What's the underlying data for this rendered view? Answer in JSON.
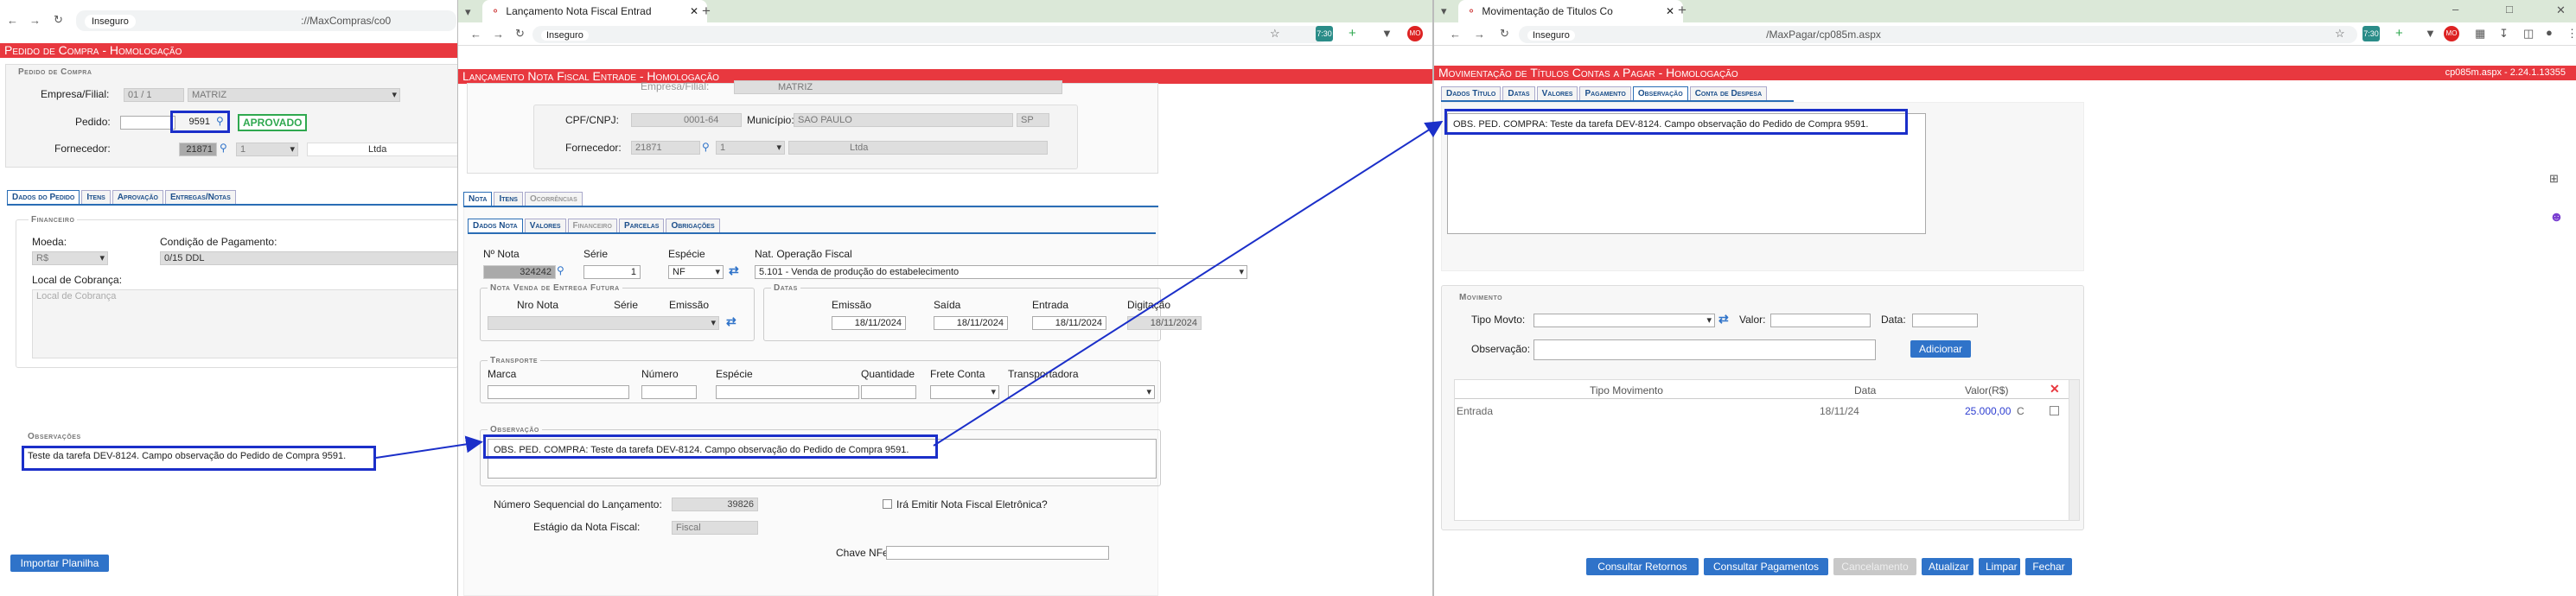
{
  "w1": {
    "tab_url": "Inseguro",
    "url": "://MaxCompras/co0",
    "title": "Pedido de Compra - Homologação",
    "section": "Pedido de Compra",
    "empresa_label": "Empresa/Filial:",
    "empresa_code": "01 / 1",
    "empresa_name": "MATRIZ",
    "pedido_label": "Pedido:",
    "pedido_value": "9591",
    "status": "APROVADO",
    "fornecedor_label": "Fornecedor:",
    "fornecedor_code": "21871",
    "fornecedor_seq": "1",
    "fornecedor_name": "Ltda",
    "tabs": [
      "Dados do Pedido",
      "Itens",
      "Aprovação",
      "Entregas/Notas"
    ],
    "fin_section": "Financeiro",
    "moeda_label": "Moeda:",
    "moeda_value": "R$",
    "cond_label": "Condição de Pagamento:",
    "cond_value": "0/15 DDL",
    "local_label": "Local de Cobrança:",
    "local_placeholder": "Local de Cobrança",
    "obs_section": "Observações",
    "obs_text": "Teste da tarefa DEV-8124. Campo observação do Pedido de Compra 9591.",
    "import_btn": "Importar Planilha"
  },
  "w2": {
    "tab_title": "Lançamento Nota Fiscal Entrad",
    "omni_label": "Inseguro",
    "title": "Lançamento Nota Fiscal Entrade - Homologação",
    "empresa_label": "Empresa/Filial:",
    "empresa_value": "MATRIZ",
    "cpf_label": "CPF/CNPJ:",
    "cpf_value": "0001-64",
    "municipio_label": "Município:",
    "municipio_value": "SAO PAULO",
    "uf_value": "SP",
    "fornecedor_label": "Fornecedor:",
    "fornecedor_code": "21871",
    "fornecedor_seq": "1",
    "fornecedor_name": "Ltda",
    "tabs_top": [
      "Nota",
      "Itens",
      "Ocorrências"
    ],
    "tabs_sub": [
      "Dados Nota",
      "Valores",
      "Financeiro",
      "Parcelas",
      "Obrigações"
    ],
    "nnota_label": "Nº Nota",
    "nnota_value": "324242",
    "serie_label": "Série",
    "serie_value": "1",
    "especie_label": "Espécie",
    "especie_value": "NF",
    "natop_label": "Nat. Operação Fiscal",
    "natop_value": "5.101 - Venda de produção do estabelecimento",
    "nvef_section": "Nota Venda de Entrega Futura",
    "nronota_label": "Nro Nota",
    "serie2_label": "Série",
    "emissao_label": "Emissão",
    "datas_section": "Datas",
    "d_emissao_label": "Emissão",
    "d_emissao": "18/11/2024",
    "d_saida_label": "Saída",
    "d_saida": "18/11/2024",
    "d_entrada_label": "Entrada",
    "d_entrada": "18/11/2024",
    "d_dig_label": "Digitação",
    "d_dig": "18/11/2024",
    "transporte_section": "Transporte",
    "marca_label": "Marca",
    "numero_label": "Número",
    "especie2_label": "Espécie",
    "quantidade_label": "Quantidade",
    "frete_label": "Frete Conta",
    "transp_label": "Transportadora",
    "obs_section": "Observação",
    "obs_text": "OBS. PED. COMPRA: Teste da tarefa DEV-8124. Campo observação do Pedido de Compra 9591.",
    "seq_label": "Número Sequencial do Lançamento:",
    "seq_value": "39826",
    "nfe_check_label": "Irá Emitir Nota Fiscal Eletrônica?",
    "estagio_label": "Estágio da Nota Fiscal:",
    "estagio_value": "Fiscal",
    "chave_label": "Chave NFe:"
  },
  "w3": {
    "tab_title": "Movimentação de Titulos Co",
    "omni_label": "Inseguro",
    "url": "/MaxPagar/cp085m.aspx",
    "badge": "7:30",
    "title": "Movimentação de Títulos Contas a Pagar - Homologação",
    "version": "cp085m.aspx - 2.24.1.13355",
    "tabs": [
      "Dados Título",
      "Datas",
      "Valores",
      "Pagamento",
      "Observação",
      "Conta de Despesa"
    ],
    "obs_text": "OBS. PED. COMPRA: Teste da tarefa DEV-8124. Campo observação do Pedido de Compra 9591.",
    "mov_section": "Movimento",
    "tipo_label": "Tipo Movto:",
    "valor_label": "Valor:",
    "data_label": "Data:",
    "obs_label": "Observação:",
    "add_btn": "Adicionar",
    "col_tipo": "Tipo Movimento",
    "col_data": "Data",
    "col_valor": "Valor(R$)",
    "row_tipo": "Entrada",
    "row_data": "18/11/24",
    "row_valor": "25.000,00",
    "row_dc": "C",
    "btn_consultar_retornos": "Consultar Retornos",
    "btn_consultar_pagamentos": "Consultar Pagamentos",
    "btn_cancelamento": "Cancelamento",
    "btn_atualizar": "Atualizar",
    "btn_limpar": "Limpar",
    "btn_fechar": "Fechar"
  },
  "colors": {
    "accent": "#e8383f",
    "link": "#2f73c9",
    "highlight": "#1b2fc9",
    "approved": "#2fa84f"
  }
}
